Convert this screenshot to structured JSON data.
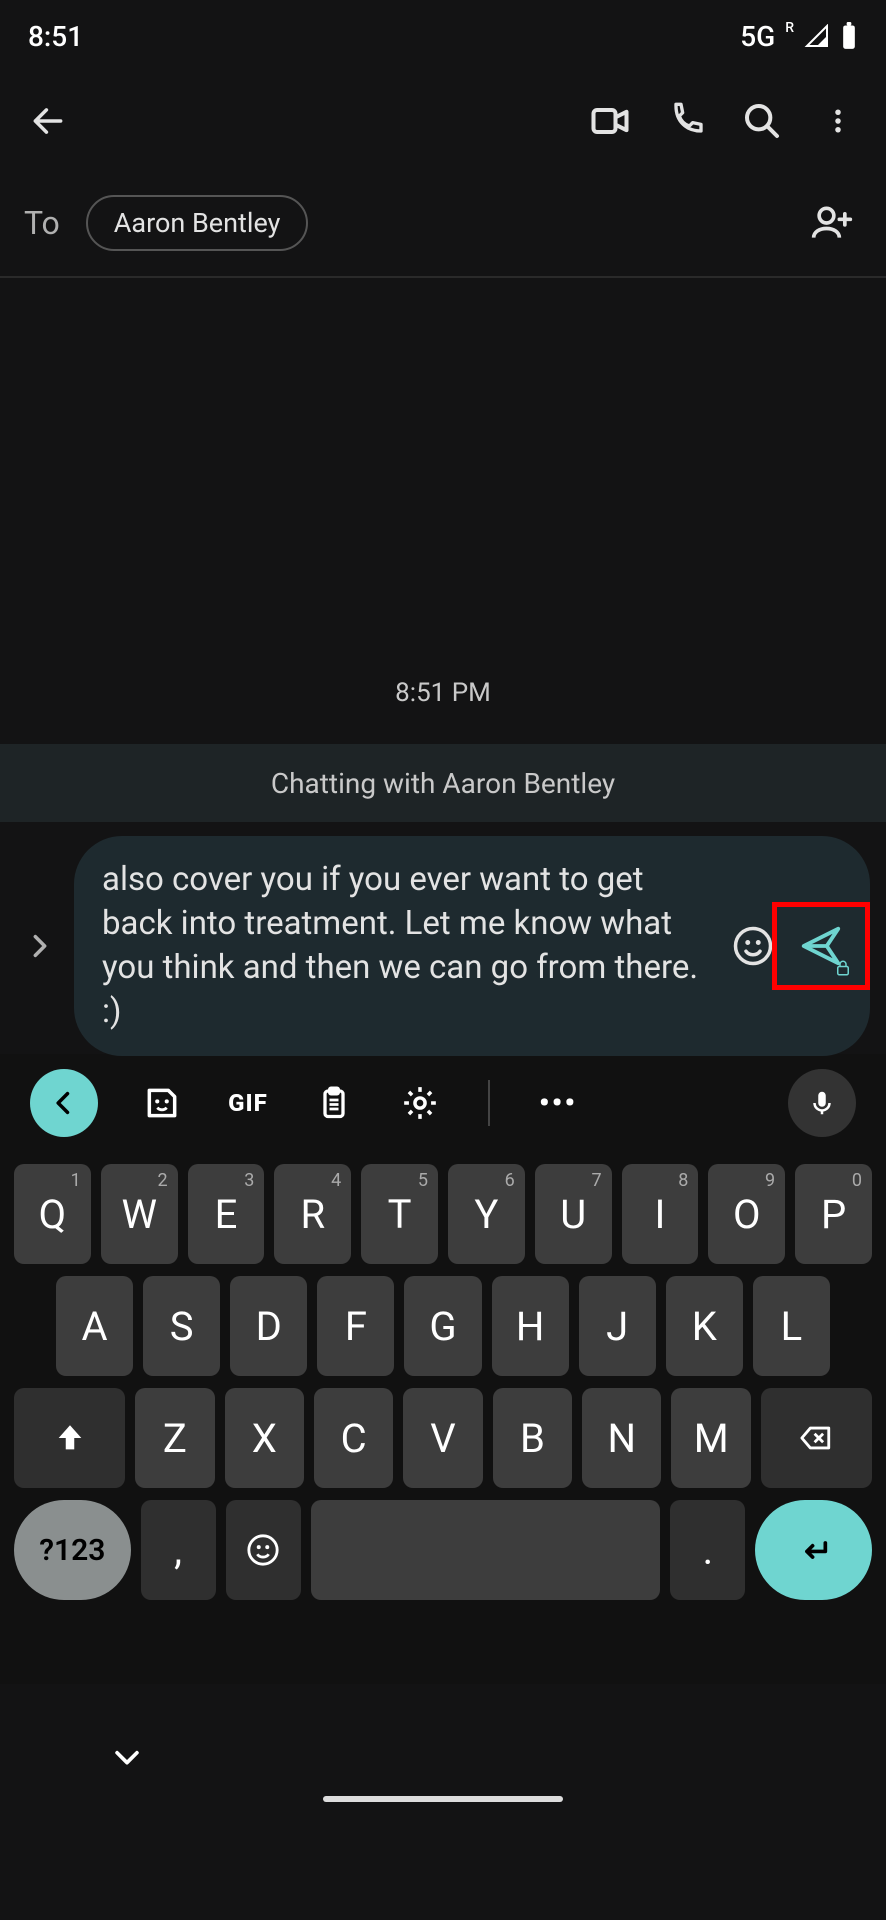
{
  "status": {
    "time": "8:51",
    "network": "5G",
    "roaming": "R"
  },
  "appbar": {},
  "to": {
    "label": "To",
    "chip": "Aaron Bentley"
  },
  "conversation": {
    "timestamp": "8:51 PM",
    "banner": "Chatting with Aaron Bentley"
  },
  "compose": {
    "text": "also cover you if you ever want to get back into treatment. Let me know what you think and then we can go from there. :)"
  },
  "keyboard": {
    "toolbar": {
      "gif": "GIF",
      "more": "•••"
    },
    "row1": [
      {
        "k": "Q",
        "s": "1"
      },
      {
        "k": "W",
        "s": "2"
      },
      {
        "k": "E",
        "s": "3"
      },
      {
        "k": "R",
        "s": "4"
      },
      {
        "k": "T",
        "s": "5"
      },
      {
        "k": "Y",
        "s": "6"
      },
      {
        "k": "U",
        "s": "7"
      },
      {
        "k": "I",
        "s": "8"
      },
      {
        "k": "O",
        "s": "9"
      },
      {
        "k": "P",
        "s": "0"
      }
    ],
    "row2": [
      "A",
      "S",
      "D",
      "F",
      "G",
      "H",
      "J",
      "K",
      "L"
    ],
    "row3": [
      "Z",
      "X",
      "C",
      "V",
      "B",
      "N",
      "M"
    ],
    "row4": {
      "switch": "?123",
      "comma": ",",
      "period": "."
    }
  }
}
